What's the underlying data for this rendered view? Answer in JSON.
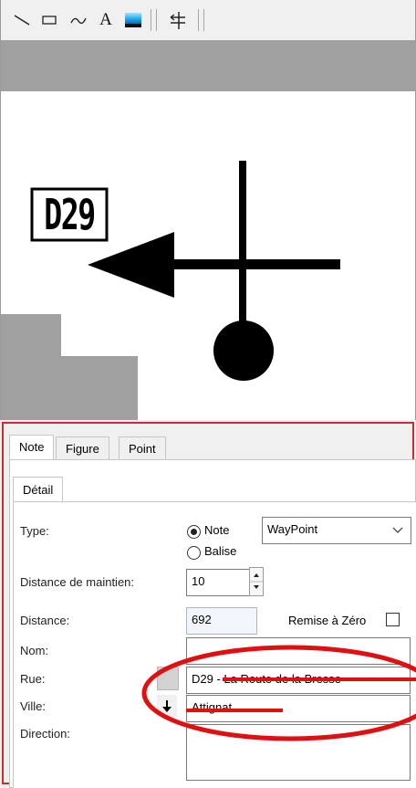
{
  "toolbar": {
    "icons": [
      "line-icon",
      "rectangle-icon",
      "curve-icon",
      "text-icon",
      "gradient-icon",
      "junction-icon"
    ],
    "text_tool_glyph": "A"
  },
  "canvas": {
    "road_label": "D29"
  },
  "tabs": [
    "Note",
    "Figure",
    "Point"
  ],
  "subtab": "Détail",
  "form": {
    "type_label": "Type:",
    "radio_note": "Note",
    "radio_balise": "Balise",
    "type_select": "WayPoint",
    "distance_maintien_label": "Distance de maintien:",
    "distance_maintien_value": "10",
    "distance_label": "Distance:",
    "distance_value": "692",
    "remise_label": "Remise à Zéro",
    "nom_label": "Nom:",
    "nom_value": "",
    "rue_label": "Rue:",
    "rue_value": "D29 - La Route de la Bresse",
    "ville_label": "Ville:",
    "ville_value": "Attignat",
    "direction_label": "Direction:",
    "direction_value": ""
  },
  "colors": {
    "annotation_red": "#e01010",
    "banner_gray": "#a0a0a0"
  }
}
